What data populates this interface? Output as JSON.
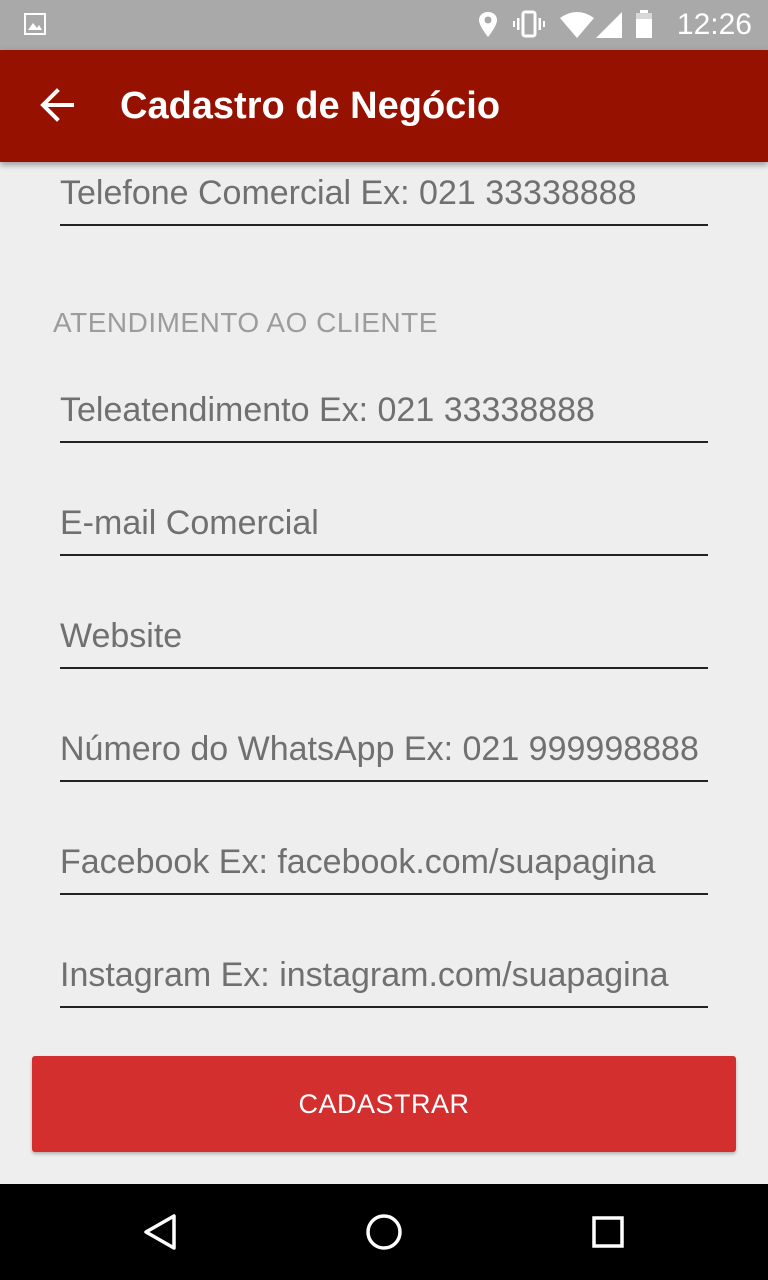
{
  "status_bar": {
    "time": "12:26",
    "icons": [
      "gallery-icon",
      "location-icon",
      "vibrate-icon",
      "wifi-icon",
      "signal-icon",
      "battery-icon"
    ]
  },
  "app_bar": {
    "title": "Cadastro de Negócio",
    "background": "#961100"
  },
  "form": {
    "partial_field_placeholder": "Telefone Comercial Ex: 021 33338888",
    "section_title": "ATENDIMENTO AO CLIENTE",
    "fields": [
      {
        "placeholder": "Teleatendimento Ex: 021 33338888",
        "value": ""
      },
      {
        "placeholder": "E-mail Comercial",
        "value": ""
      },
      {
        "placeholder": "Website",
        "value": ""
      },
      {
        "placeholder": "Número do WhatsApp Ex: 021 999998888",
        "value": ""
      },
      {
        "placeholder": "Facebook Ex: facebook.com/suapagina",
        "value": ""
      },
      {
        "placeholder": "Instagram Ex: instagram.com/suapagina",
        "value": ""
      }
    ],
    "submit_label": "CADASTRAR",
    "accent": "#d32f2f"
  },
  "nav_bar": {
    "icons": [
      "back-triangle-icon",
      "home-circle-icon",
      "recents-square-icon"
    ]
  }
}
